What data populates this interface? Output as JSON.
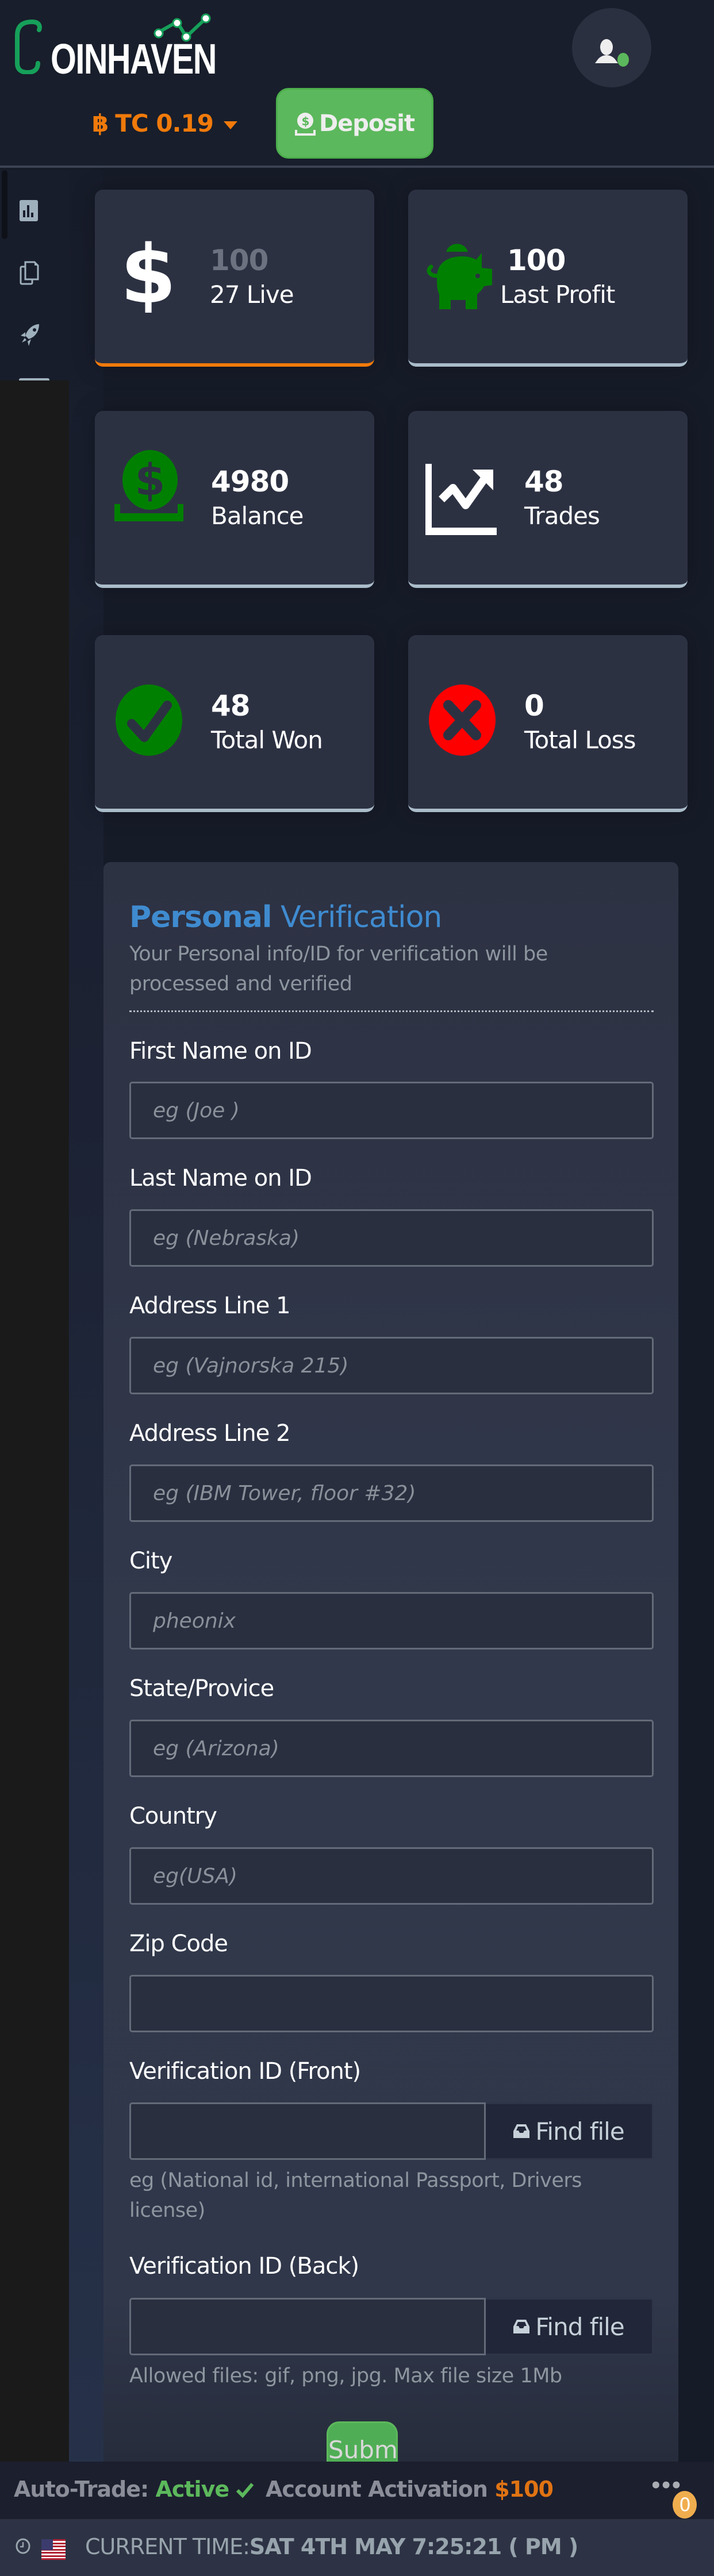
{
  "header": {
    "logo_text": "OINHAVEN",
    "balance": {
      "currency_symbol": "฿",
      "text": "TC 0.19"
    },
    "deposit_label": "Deposit",
    "colors": {
      "brand_green": "#16a05a",
      "balance_orange": "#f07a0b",
      "deposit_green": "#5cb85c"
    }
  },
  "sidebar": {
    "items": [
      {
        "icon": "bar-chart-icon"
      },
      {
        "icon": "copy-icon"
      },
      {
        "icon": "rocket-icon"
      }
    ]
  },
  "stats": [
    {
      "value": "100",
      "label": "27 Live",
      "icon": "dollar-icon"
    },
    {
      "value": "100",
      "label": "Last Profit",
      "icon": "piggy-bank-icon"
    },
    {
      "value": "4980",
      "label": "Balance",
      "icon": "money-deposit-icon"
    },
    {
      "value": "48",
      "label": "Trades",
      "icon": "trend-chart-icon"
    },
    {
      "value": "48",
      "label": "Total Won",
      "icon": "check-circle-icon"
    },
    {
      "value": "0",
      "label": "Total Loss",
      "icon": "x-circle-icon"
    }
  ],
  "form": {
    "title_bold": "Personal",
    "title_rest": "Verification",
    "subtitle": "Your Personal info/ID for verification will be processed and verified",
    "fields": [
      {
        "label": "First Name on ID",
        "placeholder": "eg (Joe )",
        "value": ""
      },
      {
        "label": "Last Name on ID",
        "placeholder": "eg (Nebraska)",
        "value": ""
      },
      {
        "label": "Address Line 1",
        "placeholder": "eg (Vajnorska 215)",
        "value": ""
      },
      {
        "label": "Address Line 2",
        "placeholder": "eg (IBM Tower, floor #32)",
        "value": ""
      },
      {
        "label": "City",
        "placeholder": "pheonix",
        "value": ""
      },
      {
        "label": "State/Provice",
        "placeholder": "eg (Arizona)",
        "value": ""
      },
      {
        "label": "Country",
        "placeholder": "eg(USA)",
        "value": ""
      },
      {
        "label": "Zip Code",
        "placeholder": "",
        "value": ""
      }
    ],
    "id_front": {
      "label": "Verification ID (Front)",
      "button": "Find file",
      "help": "eg (National id, international Passport, Drivers license)"
    },
    "id_back": {
      "label": "Verification ID (Back)",
      "button": "Find file",
      "help": "Allowed files: gif, png, jpg. Max file size 1Mb"
    },
    "submit_label": "Submit"
  },
  "status_bar": {
    "auto_trade_label": "Auto-Trade:",
    "auto_trade_status": "Active",
    "activation_label": "Account Activation",
    "activation_amount": "$100",
    "more_dots": "•••",
    "notification_count": "0"
  },
  "time_bar": {
    "label": "CURRENT TIME:",
    "value": "SAT 4TH MAY 7:25:21 ( PM )"
  }
}
